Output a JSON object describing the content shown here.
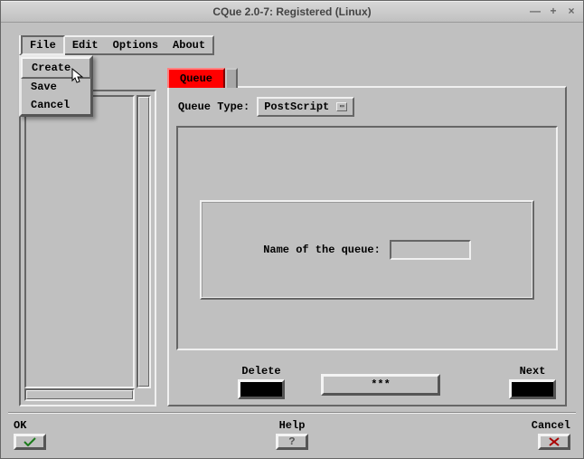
{
  "window": {
    "title": "CQue 2.0-7: Registered (Linux)"
  },
  "menubar": {
    "items": [
      "File",
      "Edit",
      "Options",
      "About"
    ],
    "open_index": 0
  },
  "file_menu": {
    "items": [
      "Create",
      "Save",
      "Cancel"
    ],
    "highlighted_index": 0
  },
  "left": {
    "obscured_label_suffix": ":"
  },
  "tabs": {
    "items": [
      "Queue"
    ],
    "active_index": 0
  },
  "queue_panel": {
    "type_label": "Queue Type:",
    "type_value": "PostScript",
    "name_label": "Name of the queue:",
    "name_value": "",
    "delete_label": "Delete",
    "middle_label": "***",
    "next_label": "Next"
  },
  "footer": {
    "ok_label": "OK",
    "help_label": "Help",
    "cancel_label": "Cancel"
  },
  "colors": {
    "accent": "#ff0000",
    "ok_glyph": "#1a7a1a",
    "cancel_glyph": "#aa0000",
    "help_glyph": "#555555"
  }
}
